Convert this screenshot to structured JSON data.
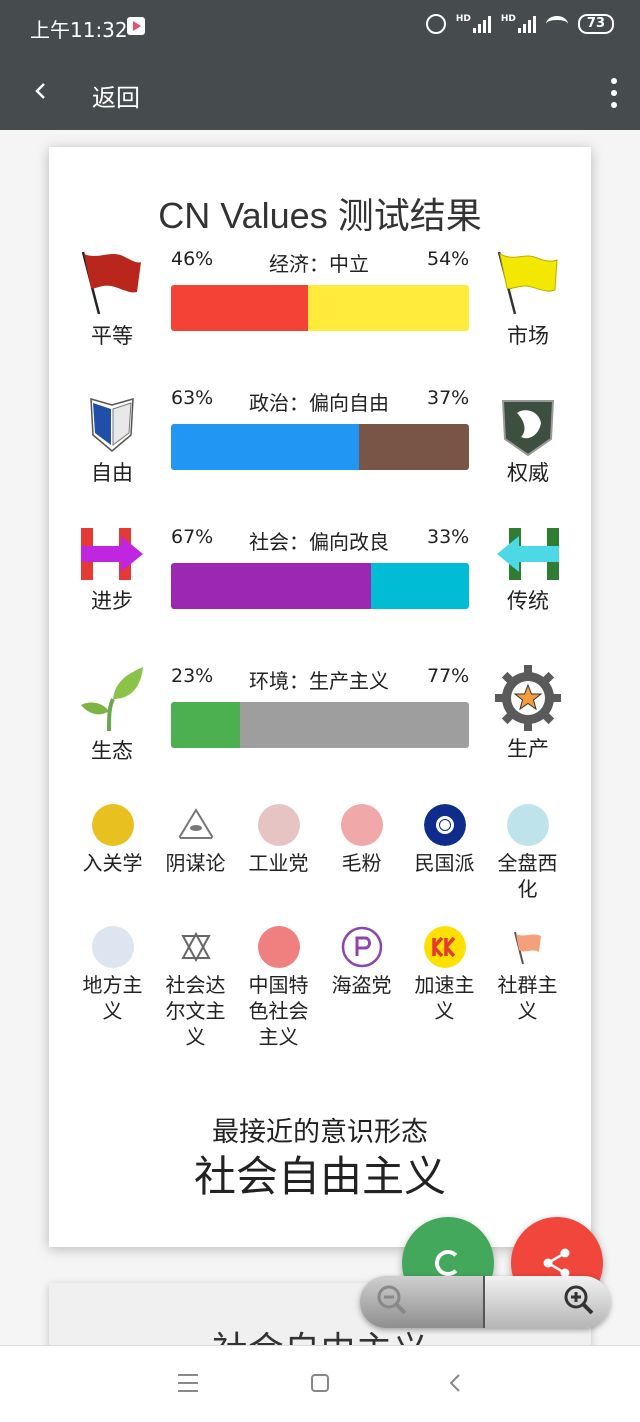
{
  "status_bar": {
    "time": "上午11:32",
    "battery": "73",
    "network": "HD"
  },
  "app_bar": {
    "back_label": "返回"
  },
  "card": {
    "title": "CN Values 测试结果",
    "axes": [
      {
        "left_pct": "46%",
        "right_pct": "54%",
        "left_value": 46,
        "name": "经济：中立",
        "left_label": "平等",
        "right_label": "市场",
        "left_color": "#f44336",
        "right_color": "#ffeb3b",
        "left_icon": "red-flag-icon",
        "right_icon": "yellow-flag-icon"
      },
      {
        "left_pct": "63%",
        "right_pct": "37%",
        "left_value": 63,
        "name": "政治：偏向自由",
        "left_label": "自由",
        "right_label": "权威",
        "left_color": "#2196f3",
        "right_color": "#795548",
        "left_icon": "wings-emblem-icon",
        "right_icon": "unicorn-shield-icon"
      },
      {
        "left_pct": "67%",
        "right_pct": "33%",
        "left_value": 67,
        "name": "社会：偏向改良",
        "left_label": "进步",
        "right_label": "传统",
        "left_color": "#9c27b0",
        "right_color": "#00bcd4",
        "left_icon": "h-arrow-right-icon",
        "right_icon": "h-arrow-left-icon"
      },
      {
        "left_pct": "23%",
        "right_pct": "77%",
        "left_value": 23,
        "name": "环境：生产主义",
        "left_label": "生态",
        "right_label": "生产",
        "left_color": "#4caf50",
        "right_color": "#9e9e9e",
        "left_icon": "sprout-icon",
        "right_icon": "gear-star-icon"
      }
    ],
    "badges_row1": [
      {
        "label": "入关学",
        "icon": "ruguan-badge-icon",
        "color": "#e8c020"
      },
      {
        "label": "阴谋论",
        "icon": "eye-pyramid-icon",
        "color": "#ffffff"
      },
      {
        "label": "工业党",
        "icon": "industry-badge-icon",
        "color": "#e7c4c4"
      },
      {
        "label": "毛粉",
        "icon": "portrait-badge-icon",
        "color": "#f0a8a8"
      },
      {
        "label": "民国派",
        "icon": "white-sun-icon",
        "color": "#0d2c8c"
      },
      {
        "label": "全盘西化",
        "icon": "liberty-statue-icon",
        "color": "#bfe3ea"
      }
    ],
    "badges_row2": [
      {
        "label": "地方主义",
        "icon": "wd-badge-icon",
        "color": "#dde5f0"
      },
      {
        "label": "社会达尔文主义",
        "icon": "sda-badge-icon",
        "color": "#ffffff"
      },
      {
        "label": "中国特色社会主义",
        "icon": "emblem-badge-icon",
        "color": "#f08080"
      },
      {
        "label": "海盗党",
        "icon": "pirate-badge-icon",
        "color": "#ffffff"
      },
      {
        "label": "加速主义",
        "icon": "kk-badge-icon",
        "color": "#ffe000"
      },
      {
        "label": "社群主义",
        "icon": "orange-flag-icon",
        "color": "#ffffff"
      }
    ],
    "closest_label": "最接近的意识形态",
    "closest_value": "社会自由主义"
  },
  "card2": {
    "title": "社会自由主义"
  }
}
